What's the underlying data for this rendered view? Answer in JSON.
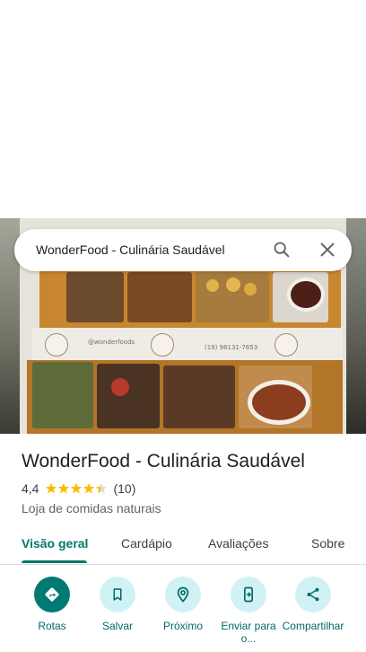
{
  "search": {
    "query": "WonderFood - Culinária Saudável"
  },
  "photo_text": {
    "instagram": "@wonderfoods",
    "phone": "(19) 98131-7653",
    "logo": "WonderFood"
  },
  "place": {
    "name": "WonderFood - Culinária Saudável",
    "rating": "4,4",
    "rating_value": 4.4,
    "review_count": "(10)",
    "category": "Loja de comidas naturais"
  },
  "tabs": [
    {
      "label": "Visão geral",
      "active": true
    },
    {
      "label": "Cardápio",
      "active": false
    },
    {
      "label": "Avaliações",
      "active": false
    },
    {
      "label": "Sobre",
      "active": false
    }
  ],
  "actions": [
    {
      "label": "Rotas",
      "icon": "directions-icon"
    },
    {
      "label": "Salvar",
      "icon": "bookmark-icon"
    },
    {
      "label": "Próximo",
      "icon": "nearby-icon"
    },
    {
      "label": "Enviar para o...",
      "icon": "send-to-phone-icon"
    },
    {
      "label": "Compartilhar",
      "icon": "share-icon"
    }
  ],
  "colors": {
    "accent": "#00796b",
    "action_bg": "#d1f2f4",
    "star": "#fbbc04"
  }
}
